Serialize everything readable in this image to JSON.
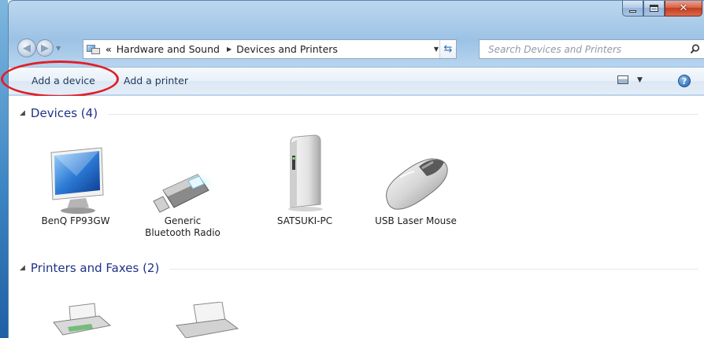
{
  "navigation": {
    "breadcrumb_separator": "«",
    "breadcrumbs": [
      "Hardware and Sound",
      "Devices and Printers"
    ],
    "search_placeholder": "Search Devices and Printers"
  },
  "toolbar": {
    "add_device_label": "Add a device",
    "add_printer_label": "Add a printer",
    "help_label": "?"
  },
  "groups": {
    "devices": {
      "title": "Devices (4)",
      "items": [
        {
          "label": "BenQ FP93GW",
          "icon": "monitor-icon"
        },
        {
          "label": "Generic",
          "label2": "Bluetooth Radio",
          "icon": "usb-bluetooth-icon"
        },
        {
          "label": "SATSUKI-PC",
          "icon": "computer-tower-icon"
        },
        {
          "label": "USB Laser Mouse",
          "icon": "mouse-icon"
        }
      ]
    },
    "printers": {
      "title": "Printers and Faxes (2)",
      "items": [
        {
          "label": "",
          "icon": "fax-printer-icon"
        },
        {
          "label": "",
          "icon": "printer-icon"
        }
      ]
    }
  },
  "colors": {
    "highlight_ring": "#e0202a",
    "group_title": "#1e3287",
    "close_button": "#c43c1c"
  }
}
